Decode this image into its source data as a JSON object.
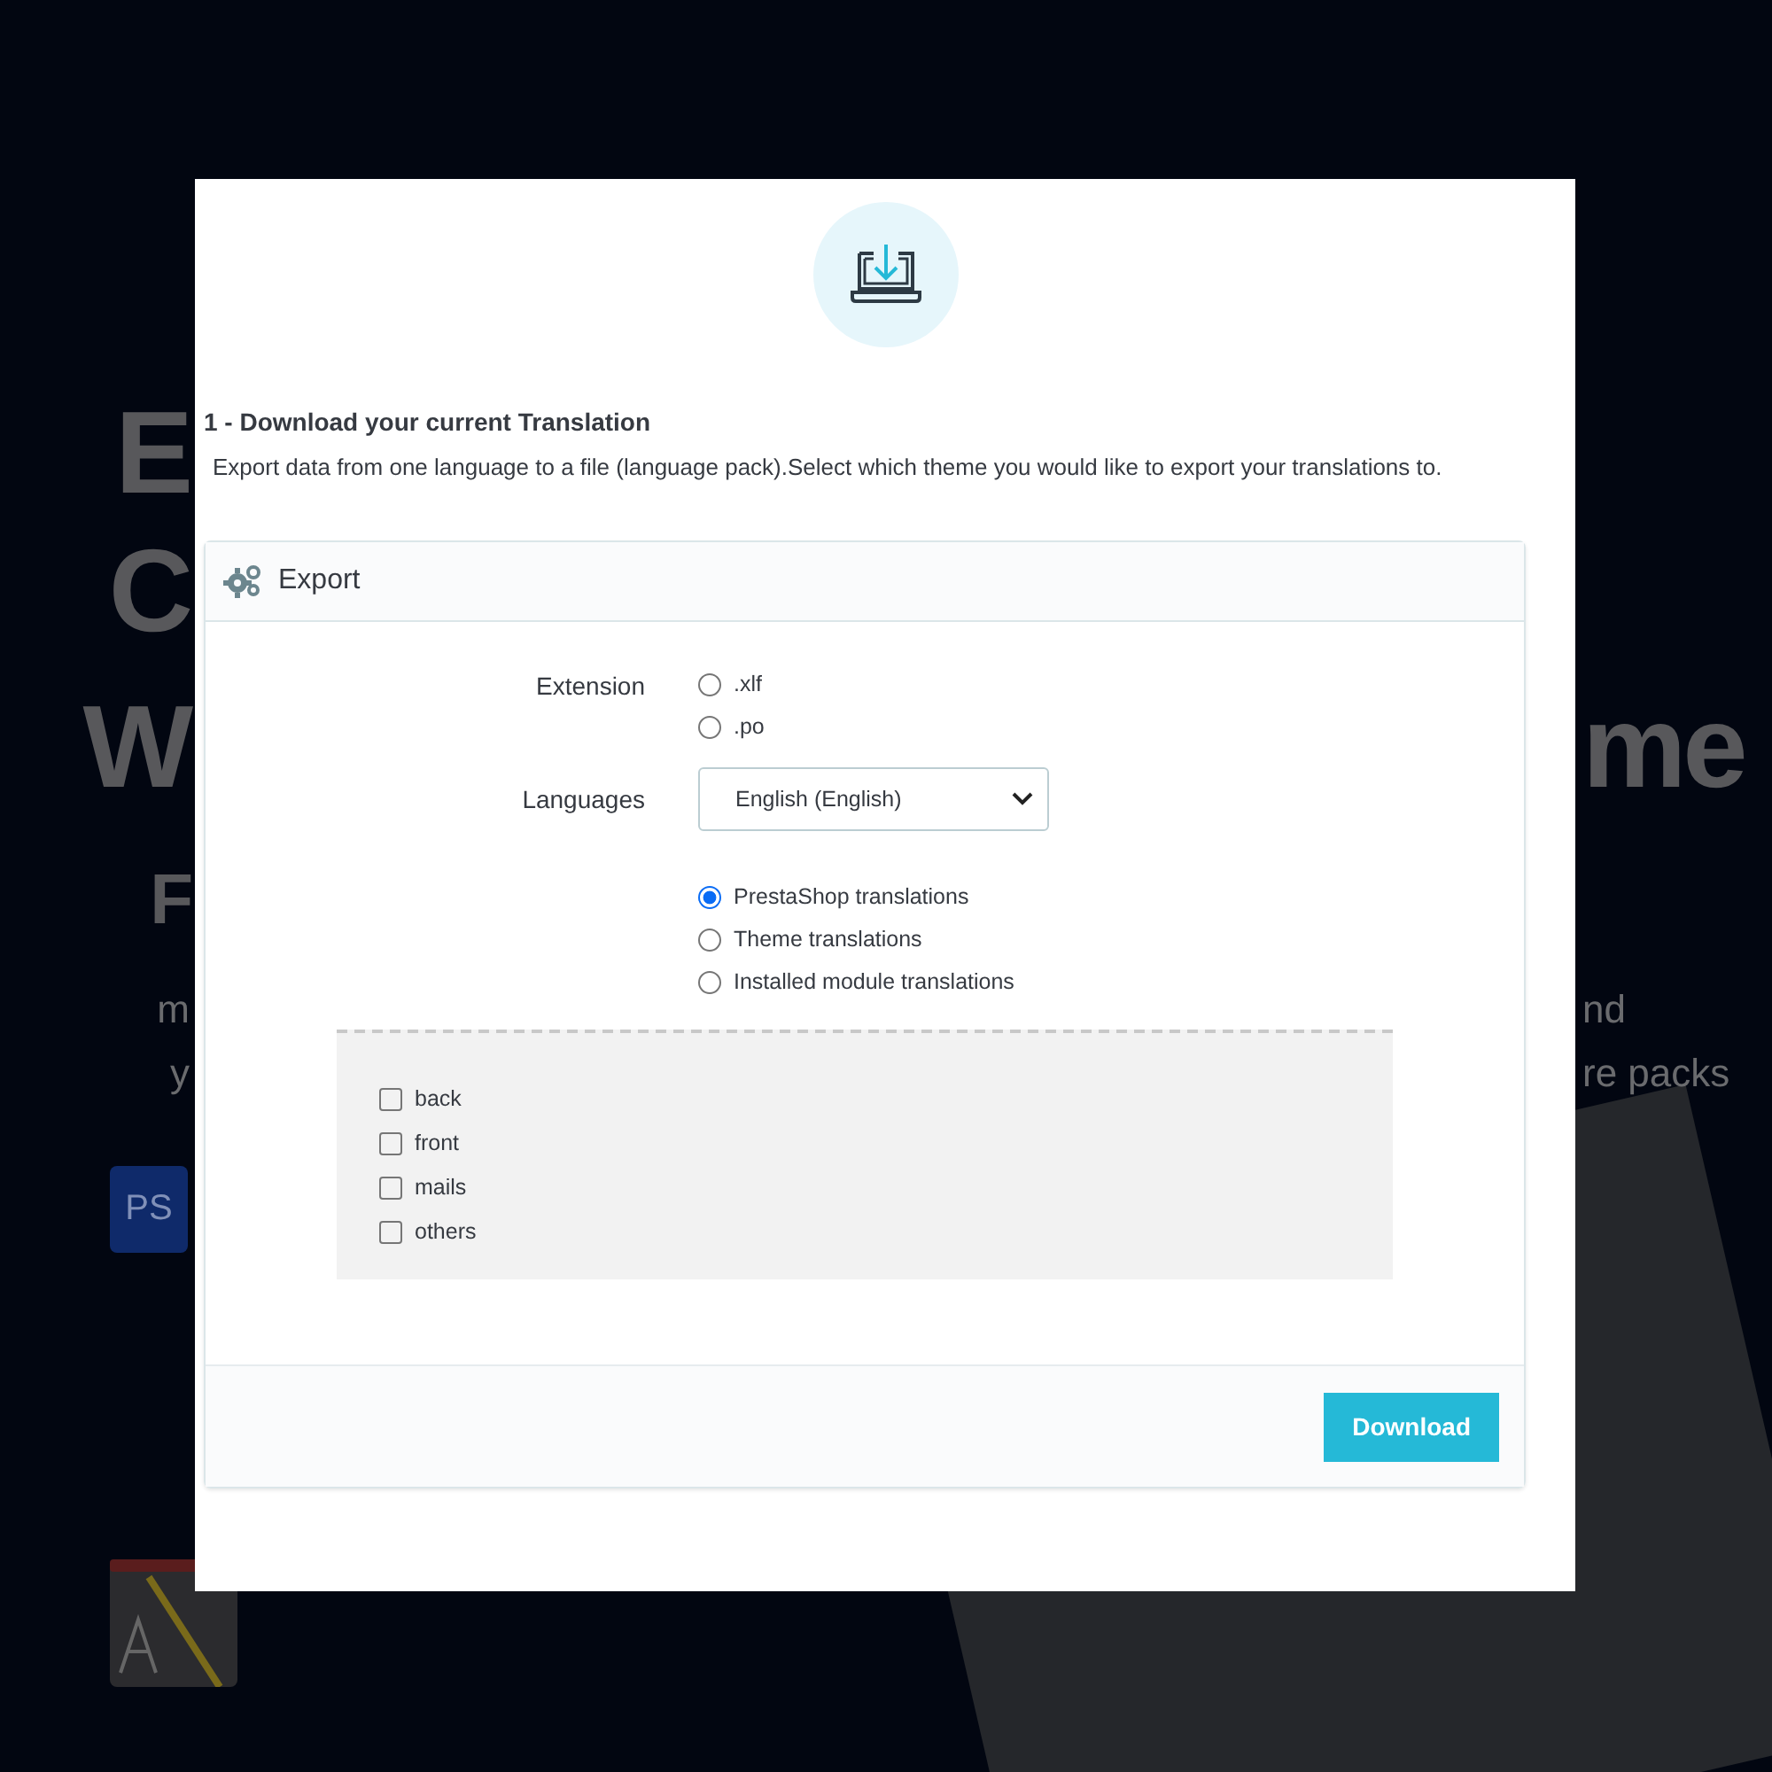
{
  "backdrop": {
    "headline_fragments": [
      "E",
      "C",
      "W",
      "me",
      "F"
    ],
    "text_fragments": [
      "m",
      "nd",
      "y",
      "re packs"
    ],
    "button": "PS"
  },
  "modal": {
    "heading": "1 - Download your current Translation",
    "description": "Export data from one language to a file (language pack).Select which theme you would like to export your translations to.",
    "panel": {
      "title": "Export",
      "extension": {
        "label": "Extension",
        "options": [
          {
            "label": ".xlf",
            "selected": false
          },
          {
            "label": ".po",
            "selected": false
          }
        ]
      },
      "languages": {
        "label": "Languages",
        "value": "English (English)"
      },
      "types": [
        {
          "label": "PrestaShop translations",
          "selected": true
        },
        {
          "label": "Theme translations",
          "selected": false
        },
        {
          "label": "Installed module translations",
          "selected": false
        }
      ],
      "scopes": [
        {
          "label": "back",
          "checked": false
        },
        {
          "label": "front",
          "checked": false
        },
        {
          "label": "mails",
          "checked": false
        },
        {
          "label": "others",
          "checked": false
        }
      ],
      "button": "Download"
    }
  }
}
